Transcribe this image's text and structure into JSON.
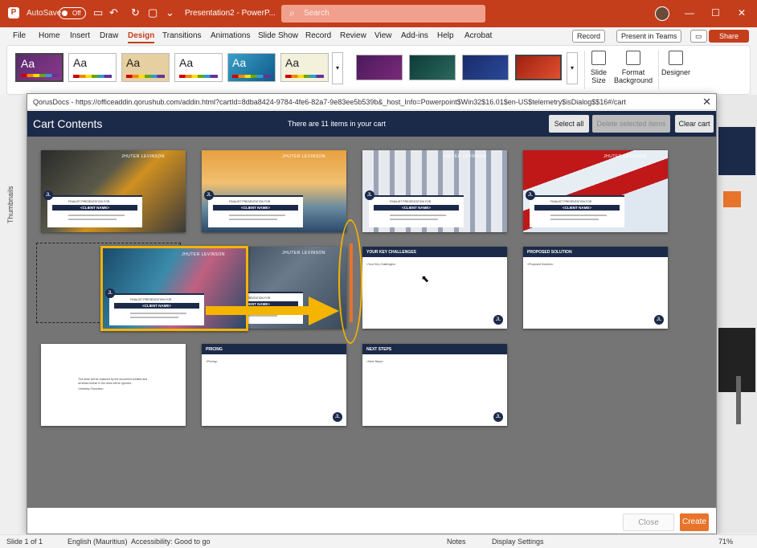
{
  "titlebar": {
    "autosave_label": "AutoSave",
    "autosave_state": "Off",
    "document_title": "Presentation2 - PowerP...",
    "search_placeholder": "Search"
  },
  "menu": {
    "tabs": [
      "File",
      "Home",
      "Insert",
      "Draw",
      "Design",
      "Transitions",
      "Animations",
      "Slide Show",
      "Record",
      "Review",
      "View",
      "Add-ins",
      "Help",
      "Acrobat"
    ],
    "active_tab": "Design",
    "record_label": "Record",
    "present_label": "Present in Teams",
    "share_label": "Share"
  },
  "ribbon": {
    "theme_label": "Aa",
    "slide_size_label": "Slide Size",
    "format_background_label": "Format Background",
    "designer_label": "Designer"
  },
  "thumbnails_label": "Thumbnails",
  "dialog": {
    "title": "QorusDocs - https://officeaddin.qorushub.com/addin.html?cartId=8dba8424-9784-4fe6-82a7-9e83ee5b539b&_host_Info=Powerpoint$Win32$16.01$en-US$telemetry$isDialog$$16#/cart",
    "header_title": "Cart Contents",
    "item_count_text": "There are 11 items in your cart",
    "select_all": "Select all",
    "delete_selected": "Delete selected items",
    "clear_cart": "Clear cart",
    "close_button": "Close",
    "create_button": "Create"
  },
  "slides": {
    "watermark": "JHUTER LEVINSON",
    "title_pre": "FINALIST PRESENTATION FOR",
    "client_name": "<CLIENT NAME>",
    "logo": "JL",
    "key_challenges": "YOUR KEY CHALLENGES",
    "key_challenges_body": "<Your Key Challenges>",
    "proposed_solution": "PROPOSED SOLUTION",
    "proposed_solution_body": "<Proposed Solution>",
    "pricing": "PRICING",
    "pricing_body": "<Pricing>",
    "next_steps": "NEXT STEPS",
    "next_steps_body": "<Next Steps>",
    "summary_text": "This slide will be replaced by the document created and all slides further in the deck will be ignored.",
    "summary_sub": "<Industry Overview>"
  },
  "statusbar": {
    "slide_info": "Slide 1 of 1",
    "language": "English (Mauritius)",
    "accessibility": "Accessibility: Good to go",
    "notes": "Notes",
    "display_settings": "Display Settings",
    "zoom": "71%"
  },
  "colors": {
    "accent": "#c43e1c",
    "navy": "#1c2a4a",
    "highlight": "#f4b400",
    "create": "#e8732a"
  }
}
